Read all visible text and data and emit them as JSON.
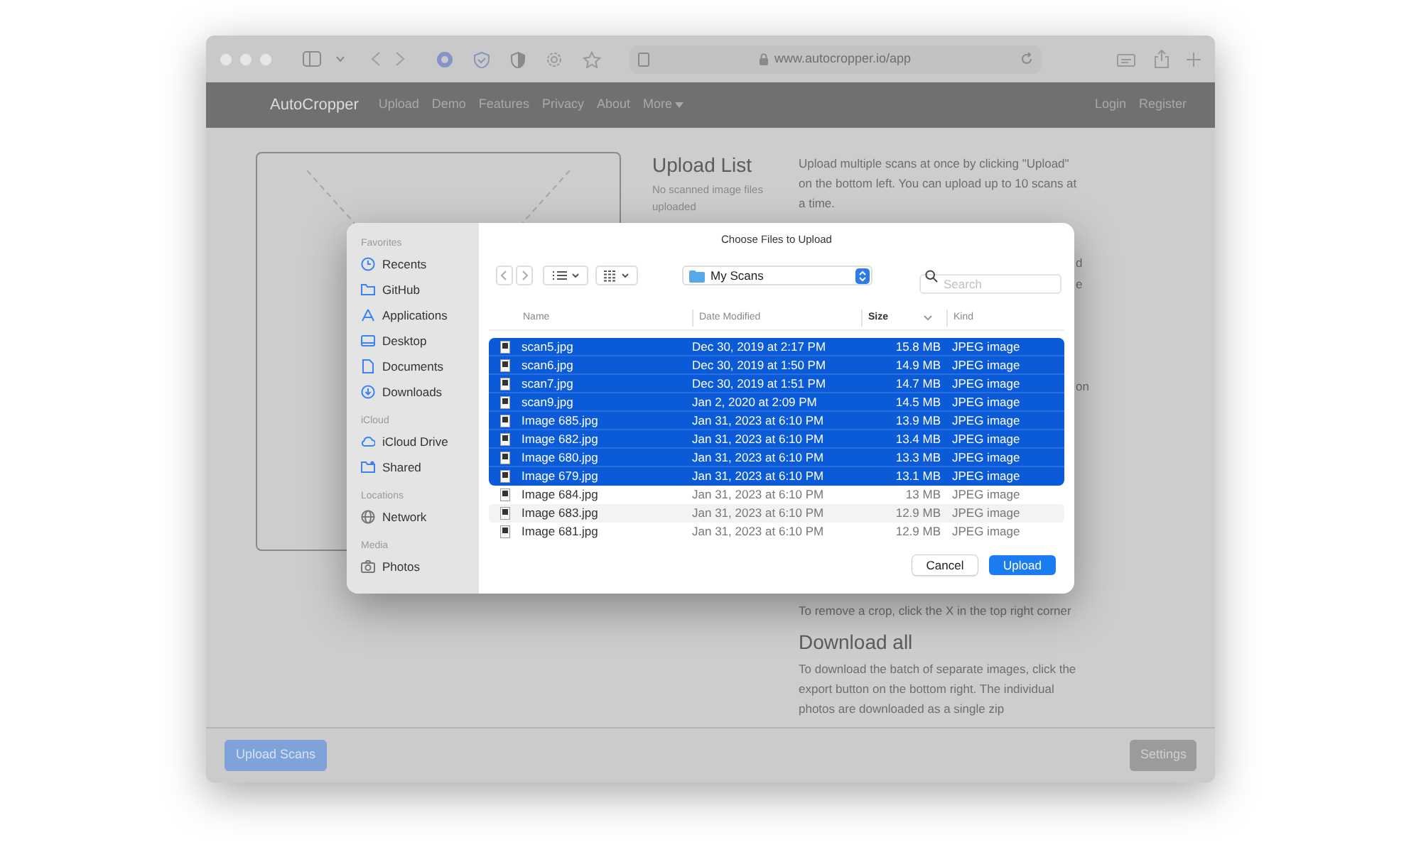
{
  "browser": {
    "url": "www.autocropper.io/app"
  },
  "navbar": {
    "brand": "AutoCropper",
    "links": [
      {
        "label": "Upload",
        "dropdown": false
      },
      {
        "label": "Demo",
        "dropdown": false
      },
      {
        "label": "Features",
        "dropdown": false
      },
      {
        "label": "Privacy",
        "dropdown": false
      },
      {
        "label": "About",
        "dropdown": false
      },
      {
        "label": "More",
        "dropdown": true
      }
    ],
    "right_links": [
      "Login",
      "Register"
    ]
  },
  "upload_list": {
    "title": "Upload List",
    "empty_text": "No scanned image files uploaded"
  },
  "help": {
    "intro": "Upload multiple scans at once by clicking \"Upload\" on the bottom left. You can upload up to 10 scans at a time.",
    "hidden_fragments": [
      "d",
      "e",
      "on"
    ],
    "remove_text": "To remove a crop, click the X in the top right corner",
    "download_title": "Download all",
    "download_text": "To download the batch of separate images, click the export button on the bottom right. The individual photos are downloaded as a single zip"
  },
  "dialog": {
    "title": "Choose Files to Upload",
    "location": "My Scans",
    "search_placeholder": "Search",
    "sidebar": [
      {
        "heading": "Favorites",
        "items": [
          {
            "label": "Recents"
          },
          {
            "label": "GitHub"
          },
          {
            "label": "Applications"
          },
          {
            "label": "Desktop"
          },
          {
            "label": "Documents"
          },
          {
            "label": "Downloads"
          }
        ]
      },
      {
        "heading": "iCloud",
        "items": [
          {
            "label": "iCloud Drive"
          },
          {
            "label": "Shared"
          }
        ]
      },
      {
        "heading": "Locations",
        "items": [
          {
            "label": "Network"
          }
        ]
      },
      {
        "heading": "Media",
        "items": [
          {
            "label": "Photos"
          }
        ]
      }
    ],
    "columns": [
      {
        "label": "Name",
        "sorted": false
      },
      {
        "label": "Date Modified",
        "sorted": false
      },
      {
        "label": "Size",
        "sorted": true
      },
      {
        "label": "Kind",
        "sorted": false
      }
    ],
    "rows": [
      {
        "name": "scan5.jpg",
        "date": "Dec 30, 2019 at 2:17 PM",
        "size": "15.8 MB",
        "kind": "JPEG image",
        "selected": true
      },
      {
        "name": "scan6.jpg",
        "date": "Dec 30, 2019 at 1:50 PM",
        "size": "14.9 MB",
        "kind": "JPEG image",
        "selected": true
      },
      {
        "name": "scan7.jpg",
        "date": "Dec 30, 2019 at 1:51 PM",
        "size": "14.7 MB",
        "kind": "JPEG image",
        "selected": true
      },
      {
        "name": "scan9.jpg",
        "date": "Jan 2, 2020 at 2:09 PM",
        "size": "14.5 MB",
        "kind": "JPEG image",
        "selected": true
      },
      {
        "name": "Image 685.jpg",
        "date": "Jan 31, 2023 at 6:10 PM",
        "size": "13.9 MB",
        "kind": "JPEG image",
        "selected": true
      },
      {
        "name": "Image 682.jpg",
        "date": "Jan 31, 2023 at 6:10 PM",
        "size": "13.4 MB",
        "kind": "JPEG image",
        "selected": true
      },
      {
        "name": "Image 680.jpg",
        "date": "Jan 31, 2023 at 6:10 PM",
        "size": "13.3 MB",
        "kind": "JPEG image",
        "selected": true
      },
      {
        "name": "Image 679.jpg",
        "date": "Jan 31, 2023 at 6:10 PM",
        "size": "13.1 MB",
        "kind": "JPEG image",
        "selected": true
      },
      {
        "name": "Image 684.jpg",
        "date": "Jan 31, 2023 at 6:10 PM",
        "size": "13 MB",
        "kind": "JPEG image",
        "selected": false
      },
      {
        "name": "Image 683.jpg",
        "date": "Jan 31, 2023 at 6:10 PM",
        "size": "12.9 MB",
        "kind": "JPEG image",
        "selected": false
      },
      {
        "name": "Image 681.jpg",
        "date": "Jan 31, 2023 at 6:10 PM",
        "size": "12.9 MB",
        "kind": "JPEG image",
        "selected": false
      }
    ],
    "buttons": [
      {
        "label": "Cancel",
        "primary": false
      },
      {
        "label": "Upload",
        "primary": true
      }
    ]
  },
  "footer": {
    "upload_button": "Upload Scans",
    "settings_button": "Settings"
  }
}
